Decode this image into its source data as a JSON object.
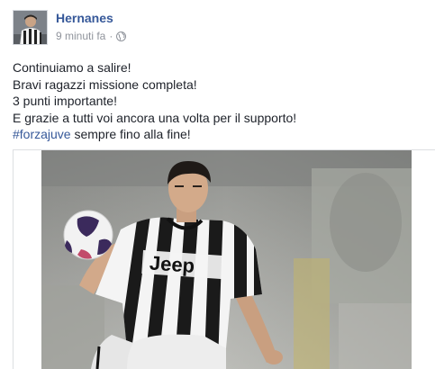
{
  "post": {
    "author": "Hernanes",
    "timestamp": "9 minuti fa",
    "privacy_icon": "globe-icon",
    "lines": [
      "Continuiamo a salire!",
      "Bravi ragazzi missione completa!",
      "3 punti importante!",
      "E grazie a tutti voi ancora una volta per il supporto!"
    ],
    "hashtag": "#forzajuve",
    "last_line_rest": " sempre fino alla fine!",
    "photo": {
      "jersey_text": "Jeep"
    }
  },
  "colors": {
    "link": "#365899",
    "text": "#1d2129",
    "meta": "#90949c"
  }
}
